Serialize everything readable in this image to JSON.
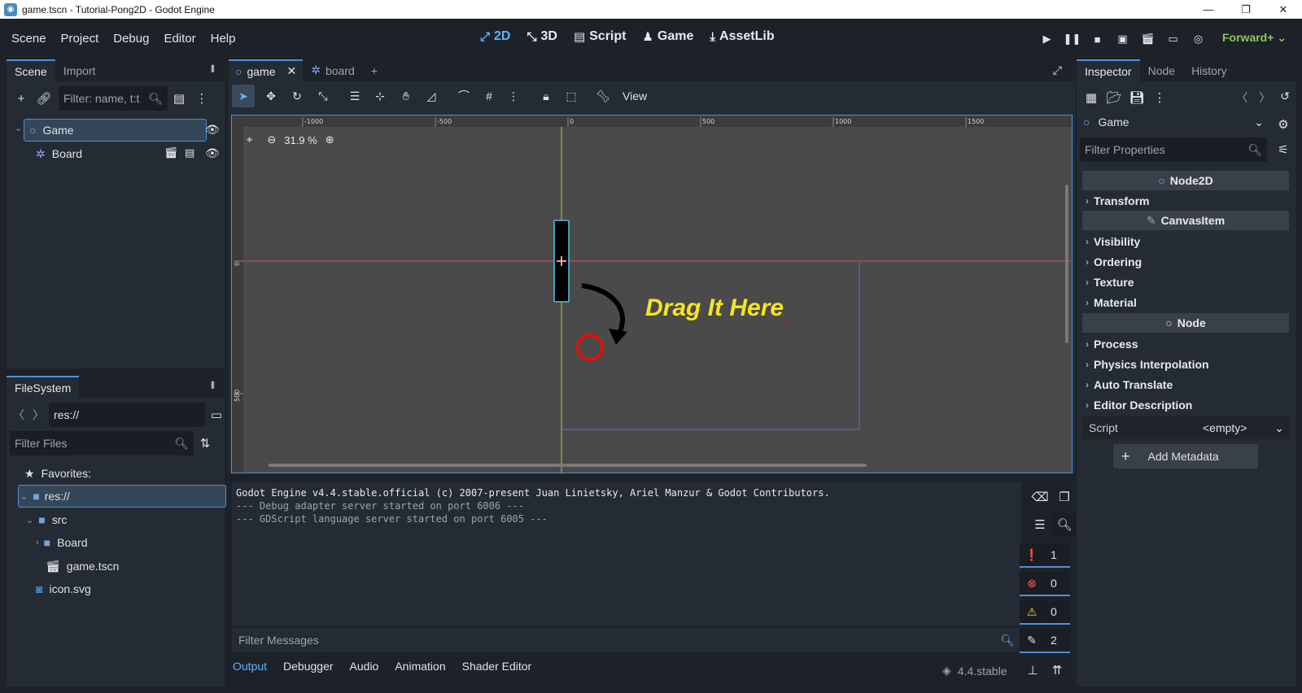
{
  "window": {
    "title": "game.tscn - Tutorial-Pong2D - Godot Engine",
    "minimize": "—",
    "maximize": "❐",
    "close": "✕"
  },
  "menu": {
    "items": [
      "Scene",
      "Project",
      "Debug",
      "Editor",
      "Help"
    ]
  },
  "workspaces": [
    {
      "label": "2D",
      "icon": "2d-icon",
      "active": true
    },
    {
      "label": "3D",
      "icon": "3d-icon"
    },
    {
      "label": "Script",
      "icon": "script-icon"
    },
    {
      "label": "Game",
      "icon": "game-icon"
    },
    {
      "label": "AssetLib",
      "icon": "assetlib-icon"
    }
  ],
  "renderer": "Forward+",
  "scene_dock": {
    "tabs": [
      "Scene",
      "Import"
    ],
    "filter_placeholder": "Filter: name, t:t",
    "tree": [
      {
        "label": "Game",
        "icon": "node2d-icon",
        "selected": true
      },
      {
        "label": "Board",
        "icon": "instance-icon"
      }
    ]
  },
  "filesystem": {
    "tab": "FileSystem",
    "path": "res://",
    "filter_placeholder": "Filter Files",
    "items": [
      {
        "label": "Favorites:",
        "icon": "star-icon"
      },
      {
        "label": "res://",
        "icon": "folder-icon",
        "selected": true
      },
      {
        "label": "src",
        "icon": "folder-icon"
      },
      {
        "label": "Board",
        "icon": "folder-icon"
      },
      {
        "label": "game.tscn",
        "icon": "scene-file-icon"
      },
      {
        "label": "icon.svg",
        "icon": "svg-file-icon"
      }
    ]
  },
  "editor_tabs": [
    {
      "label": "game",
      "active": true
    },
    {
      "label": "board"
    }
  ],
  "toolbar": {
    "view_label": "View"
  },
  "viewport": {
    "zoom": "31.9 %",
    "annotation": "Drag It Here",
    "ruler_labels": [
      "-1000",
      "-500",
      "0",
      "500",
      "1000",
      "1500"
    ],
    "vruler_labels": [
      "0",
      "500"
    ]
  },
  "output": {
    "lines": [
      "Godot Engine v4.4.stable.official (c) 2007-present Juan Linietsky, Ariel Manzur & Godot Contributors.",
      "--- Debug adapter server started on port 6006 ---",
      "--- GDScript language server started on port 6005 ---"
    ],
    "filter_placeholder": "Filter Messages",
    "counters": {
      "messages": "1",
      "errors": "0",
      "warnings": "0",
      "editor": "2"
    },
    "version": "4.4.stable"
  },
  "bottom_tabs": [
    "Output",
    "Debugger",
    "Audio",
    "Animation",
    "Shader Editor"
  ],
  "inspector": {
    "tabs": [
      "Inspector",
      "Node",
      "History"
    ],
    "object": "Game",
    "filter_placeholder": "Filter Properties",
    "sections": {
      "node2d": "Node2D",
      "transform": "Transform",
      "canvasitem": "CanvasItem",
      "visibility": "Visibility",
      "ordering": "Ordering",
      "texture": "Texture",
      "material": "Material",
      "node": "Node",
      "process": "Process",
      "physics": "Physics Interpolation",
      "autotranslate": "Auto Translate",
      "editordesc": "Editor Description"
    },
    "script_label": "Script",
    "script_value": "<empty>",
    "add_metadata": "Add Metadata"
  },
  "colors": {
    "accent": "#4f8fd6",
    "annotation": "#f5e61b",
    "renderer": "#8dc75e",
    "circle": "#e01010"
  }
}
